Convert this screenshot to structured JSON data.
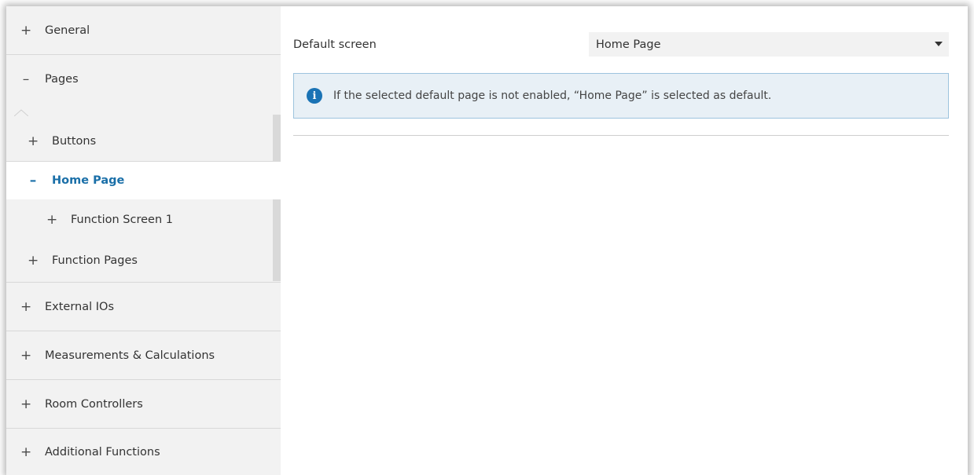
{
  "sidebar": {
    "items": [
      {
        "symbol": "+",
        "label": "General"
      },
      {
        "symbol": "–",
        "label": "Pages"
      },
      {
        "symbol": "+",
        "label": "Buttons"
      },
      {
        "symbol": "–",
        "label": "Home Page"
      },
      {
        "symbol": "+",
        "label": "Function Screen 1"
      },
      {
        "symbol": "+",
        "label": "Function Pages"
      },
      {
        "symbol": "+",
        "label": "External IOs"
      },
      {
        "symbol": "+",
        "label": "Measurements & Calculations"
      },
      {
        "symbol": "+",
        "label": "Room Controllers"
      },
      {
        "symbol": "+",
        "label": "Additional Functions"
      }
    ],
    "selected": "Home Page"
  },
  "main": {
    "default_screen": {
      "label": "Default screen",
      "value": "Home Page"
    },
    "info_message": "If the selected default page is not enabled, “Home Page” is selected as default."
  },
  "colors": {
    "accent": "#1a6fa8",
    "info_bg": "#e8f0f6",
    "info_border": "#9dc3de",
    "sidebar_bg": "#f2f2f2"
  }
}
